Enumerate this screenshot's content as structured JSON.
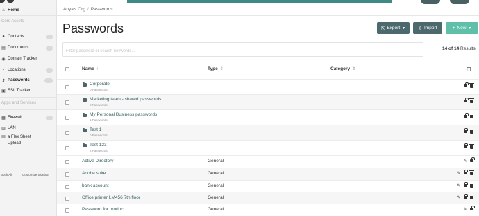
{
  "sidebar": {
    "home": "Home",
    "core_assets_header": "Core Assets",
    "items": [
      {
        "label": "Contacts",
        "icon": "contacts-icon"
      },
      {
        "label": "Documents",
        "icon": "documents-icon"
      },
      {
        "label": "Domain Tracker",
        "icon": "domain-icon"
      },
      {
        "label": "Locations",
        "icon": "location-icon"
      },
      {
        "label": "Passwords",
        "icon": "key-icon"
      },
      {
        "label": "SSL Tracker",
        "icon": "ssl-icon"
      }
    ],
    "apps_header": "Apps and Services",
    "apps": [
      {
        "label": "Firewall",
        "icon": "firewall-icon"
      },
      {
        "label": "LAN",
        "icon": "lan-icon"
      },
      {
        "label": "a Flex Sheet Upload",
        "icon": "sheet-icon"
      }
    ],
    "footer_left": "Book All",
    "footer_right": "Customize Sidebar"
  },
  "breadcrumb": {
    "org": "Anya's Org",
    "separator": "/",
    "current": "Passwords"
  },
  "page": {
    "title": "Passwords"
  },
  "toolbar": {
    "export": "Export",
    "import": "Import",
    "new": "New"
  },
  "search": {
    "placeholder": "Filter password or search keywords..."
  },
  "results": {
    "count": "14 of 14",
    "suffix": "Results"
  },
  "table": {
    "columns": {
      "name": "Name",
      "type": "Type",
      "category": "Category"
    },
    "folders": [
      {
        "name": "Corporate",
        "sub": "0 Passwords"
      },
      {
        "name": "Marketing team - shared passwords",
        "sub": "2 Passwords"
      },
      {
        "name": "My Personal Business passwords",
        "sub": "1 Passwords"
      },
      {
        "name": "Test 1",
        "sub": "0 Passwords"
      },
      {
        "name": "Test 123",
        "sub": "2 Passwords"
      }
    ],
    "items": [
      {
        "name": "Active Directory",
        "type": "General"
      },
      {
        "name": "Adobe suite",
        "type": "General"
      },
      {
        "name": "bank account",
        "type": "General"
      },
      {
        "name": "Office printer LM456 7th floor",
        "type": "General"
      },
      {
        "name": "Password for product",
        "type": "General"
      }
    ]
  },
  "colors": {
    "accent": "#3f8a86",
    "button_dark": "#4c6a6e",
    "button_new": "#5fbfa8"
  }
}
